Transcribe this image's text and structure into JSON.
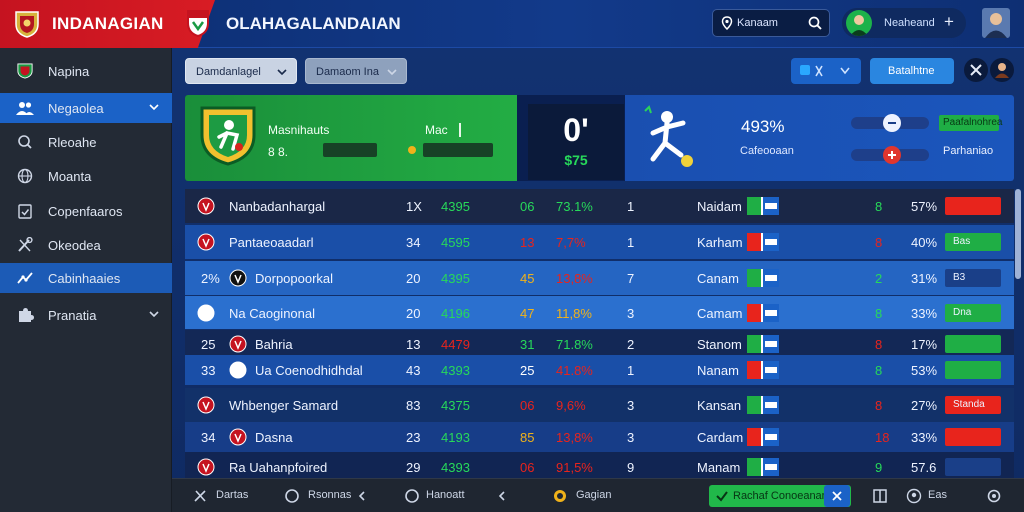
{
  "brand": {
    "name": "INDANAGIAN"
  },
  "header": {
    "title": "OLAHAGALANDAIAN",
    "search_value": "Kanaam",
    "user_name": "Neaheand",
    "add_label": "+"
  },
  "sidebar": {
    "items": [
      {
        "label": "Napina",
        "icon": "crest-icon"
      },
      {
        "label": "Negaolea",
        "icon": "users-icon"
      },
      {
        "label": "Rleoahe",
        "icon": "search-icon"
      },
      {
        "label": "Moanta",
        "icon": "globe-icon"
      },
      {
        "label": "Copenfaaros",
        "icon": "clipboard-icon"
      },
      {
        "label": "Okeodea",
        "icon": "tools-icon"
      },
      {
        "label": "Cabinhaaies",
        "icon": "chart-icon"
      },
      {
        "label": "Pranatia",
        "icon": "puzzle-icon"
      }
    ]
  },
  "toolbar": {
    "dropdown1": "Damdanlagel",
    "dropdown2": "Damaom Ina",
    "action_button": "Batalhtne"
  },
  "match_card": {
    "team_name": "Masnihauts",
    "team_value": "8 8.",
    "vs_label": "Mac",
    "score": "0'",
    "score_sub": "$75",
    "percent": "493%",
    "percent_label": "Cafeooaan",
    "tag_green": "Paafalnohrea",
    "tag_label": "Parhaniao"
  },
  "table": {
    "rows": [
      {
        "num": "",
        "name": "Nanbadanhargal",
        "c1": "1X",
        "c2": "4395",
        "c2_color": "#27d95a",
        "c3": "06",
        "c3_color": "#27d95a",
        "c4": "73.1%",
        "c4_color": "#27d95a",
        "c5": "1",
        "c6": "Naidam",
        "c7": "8",
        "c7_color": "#27d95a",
        "c8": "57%",
        "bar_color": "#e8241c",
        "bar_label": ""
      },
      {
        "num": "",
        "name": "Pantaeoaadarl",
        "c1": "34",
        "c2": "4595",
        "c2_color": "#27d95a",
        "c3": "13",
        "c3_color": "#e8241c",
        "c4": "7,7%",
        "c4_color": "#e8241c",
        "c5": "1",
        "c6": "Karham",
        "c7": "8",
        "c7_color": "#e8241c",
        "c8": "40%",
        "bar_color": "#1fae45",
        "bar_label": "Bas"
      },
      {
        "num": "2%",
        "name": "Dorpopoorkal",
        "c1": "20",
        "c2": "4395",
        "c2_color": "#27d95a",
        "c3": "45",
        "c3_color": "#f0b21a",
        "c4": "13,8%",
        "c4_color": "#e8241c",
        "c5": "7",
        "c6": "Canam",
        "c7": "2",
        "c7_color": "#27d95a",
        "c8": "31%",
        "bar_color": "#1a3f88",
        "bar_label": "B3"
      },
      {
        "num": "",
        "name": "Na Caoginonal",
        "c1": "20",
        "c2": "4196",
        "c2_color": "#27d95a",
        "c3": "47",
        "c3_color": "#f0b21a",
        "c4": "11,8%",
        "c4_color": "#f0b21a",
        "c5": "3",
        "c6": "Camam",
        "c7": "8",
        "c7_color": "#27d95a",
        "c8": "33%",
        "bar_color": "#1fae45",
        "bar_label": "Dna"
      },
      {
        "num": "25",
        "name": "Bahria",
        "c1": "13",
        "c2": "4479",
        "c2_color": "#e8241c",
        "c3": "31",
        "c3_color": "#27d95a",
        "c4": "71.8%",
        "c4_color": "#27d95a",
        "c5": "2",
        "c6": "Stanom",
        "c7": "8",
        "c7_color": "#e8241c",
        "c8": "17%",
        "bar_color": "#1fae45",
        "bar_label": ""
      },
      {
        "num": "33",
        "name": "Ua Coenodhidhdal",
        "c1": "43",
        "c2": "4393",
        "c2_color": "#27d95a",
        "c3": "25",
        "c3_color": "#ffffff",
        "c4": "41.8%",
        "c4_color": "#e8241c",
        "c5": "1",
        "c6": "Nanam",
        "c7": "8",
        "c7_color": "#27d95a",
        "c8": "53%",
        "bar_color": "#1fae45",
        "bar_label": ""
      },
      {
        "num": "",
        "name": "Whbenger Samard",
        "c1": "83",
        "c2": "4375",
        "c2_color": "#27d95a",
        "c3": "06",
        "c3_color": "#e8241c",
        "c4": "9,6%",
        "c4_color": "#e8241c",
        "c5": "3",
        "c6": "Kansan",
        "c7": "8",
        "c7_color": "#e8241c",
        "c8": "27%",
        "bar_color": "#e8241c",
        "bar_label": "Standa"
      },
      {
        "num": "34",
        "name": "Dasna",
        "c1": "23",
        "c2": "4193",
        "c2_color": "#27d95a",
        "c3": "85",
        "c3_color": "#f0b21a",
        "c4": "13,8%",
        "c4_color": "#e8241c",
        "c5": "3",
        "c6": "Cardam",
        "c7": "18",
        "c7_color": "#e8241c",
        "c8": "33%",
        "bar_color": "#e8241c",
        "bar_label": ""
      },
      {
        "num": "",
        "name": "Ra Uahanpfoired",
        "c1": "29",
        "c2": "4393",
        "c2_color": "#27d95a",
        "c3": "06",
        "c3_color": "#e8241c",
        "c4": "91,5%",
        "c4_color": "#e8241c",
        "c5": "9",
        "c6": "Manam",
        "c7": "9",
        "c7_color": "#27d95a",
        "c8": "57.6",
        "bar_color": "#1a3f88",
        "bar_label": ""
      }
    ]
  },
  "bottombar": {
    "item1": "Dartas",
    "item2": "Rsonnas",
    "item3": "Hanoatt",
    "item4": "Gagian",
    "green_button": "Rachaf Conoeanan",
    "item5": "Eas"
  }
}
